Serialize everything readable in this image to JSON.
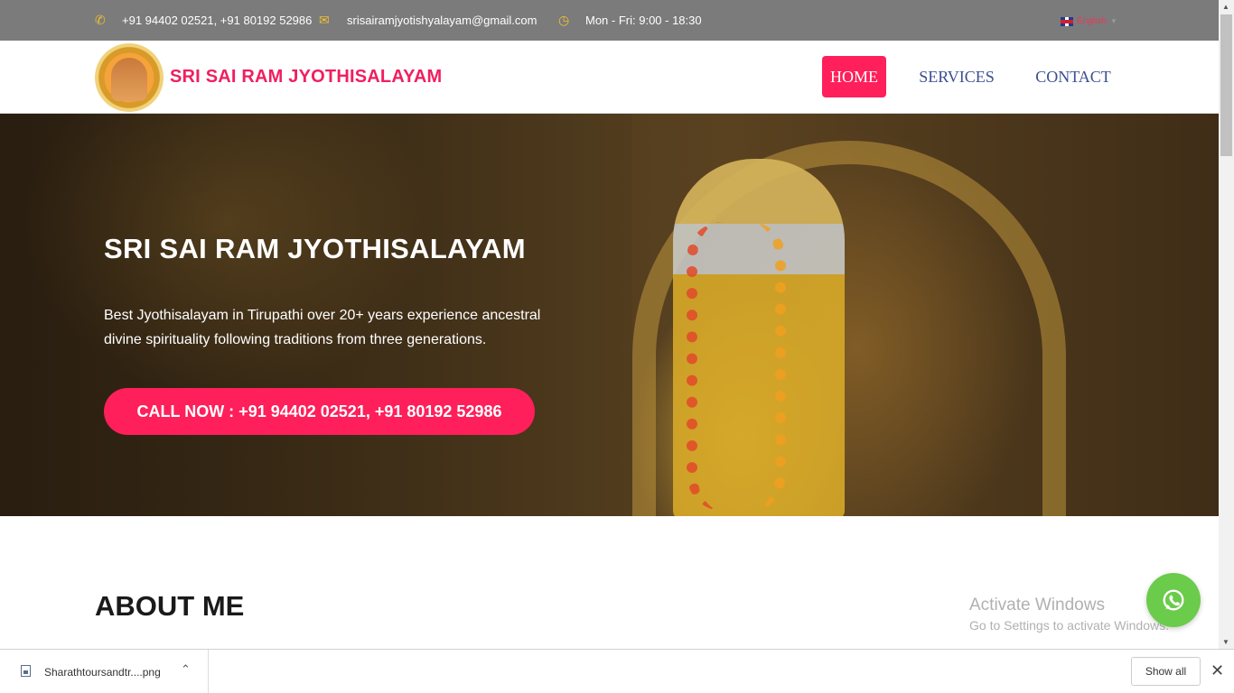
{
  "topbar": {
    "phone": "+91 94402 02521, +91 80192 52986",
    "email": "srisairamjyotishyalayam@gmail.com",
    "hours": "Mon - Fri: 9:00 - 18:30",
    "language": "English",
    "icon_color": "#f0c030"
  },
  "header": {
    "brand": "SRI SAI RAM JYOTHISALAYAM",
    "nav": [
      "HOME",
      "SERVICES",
      "CONTACT"
    ],
    "active_nav": "HOME",
    "accent": "#ff1f5a",
    "nav_color": "#3c4f8f"
  },
  "hero": {
    "title": "SRI SAI RAM JYOTHISALAYAM",
    "text": "Best Jyothisalayam in Tirupathi over 20+ years experience ancestral divine spirituality following traditions from three generations.",
    "cta": "CALL NOW : +91 94402 02521, +91 80192 52986"
  },
  "about": {
    "heading": "ABOUT ME"
  },
  "watermark": {
    "line1": "Activate Windows",
    "line2": "Go to Settings to activate Windows."
  },
  "download_bar": {
    "file_name": "Sharathtoursandtr....png",
    "show_all": "Show all"
  },
  "icons": {
    "phone": "phone-icon",
    "email": "envelope-icon",
    "clock": "clock-icon",
    "whatsapp": "whatsapp-icon"
  }
}
